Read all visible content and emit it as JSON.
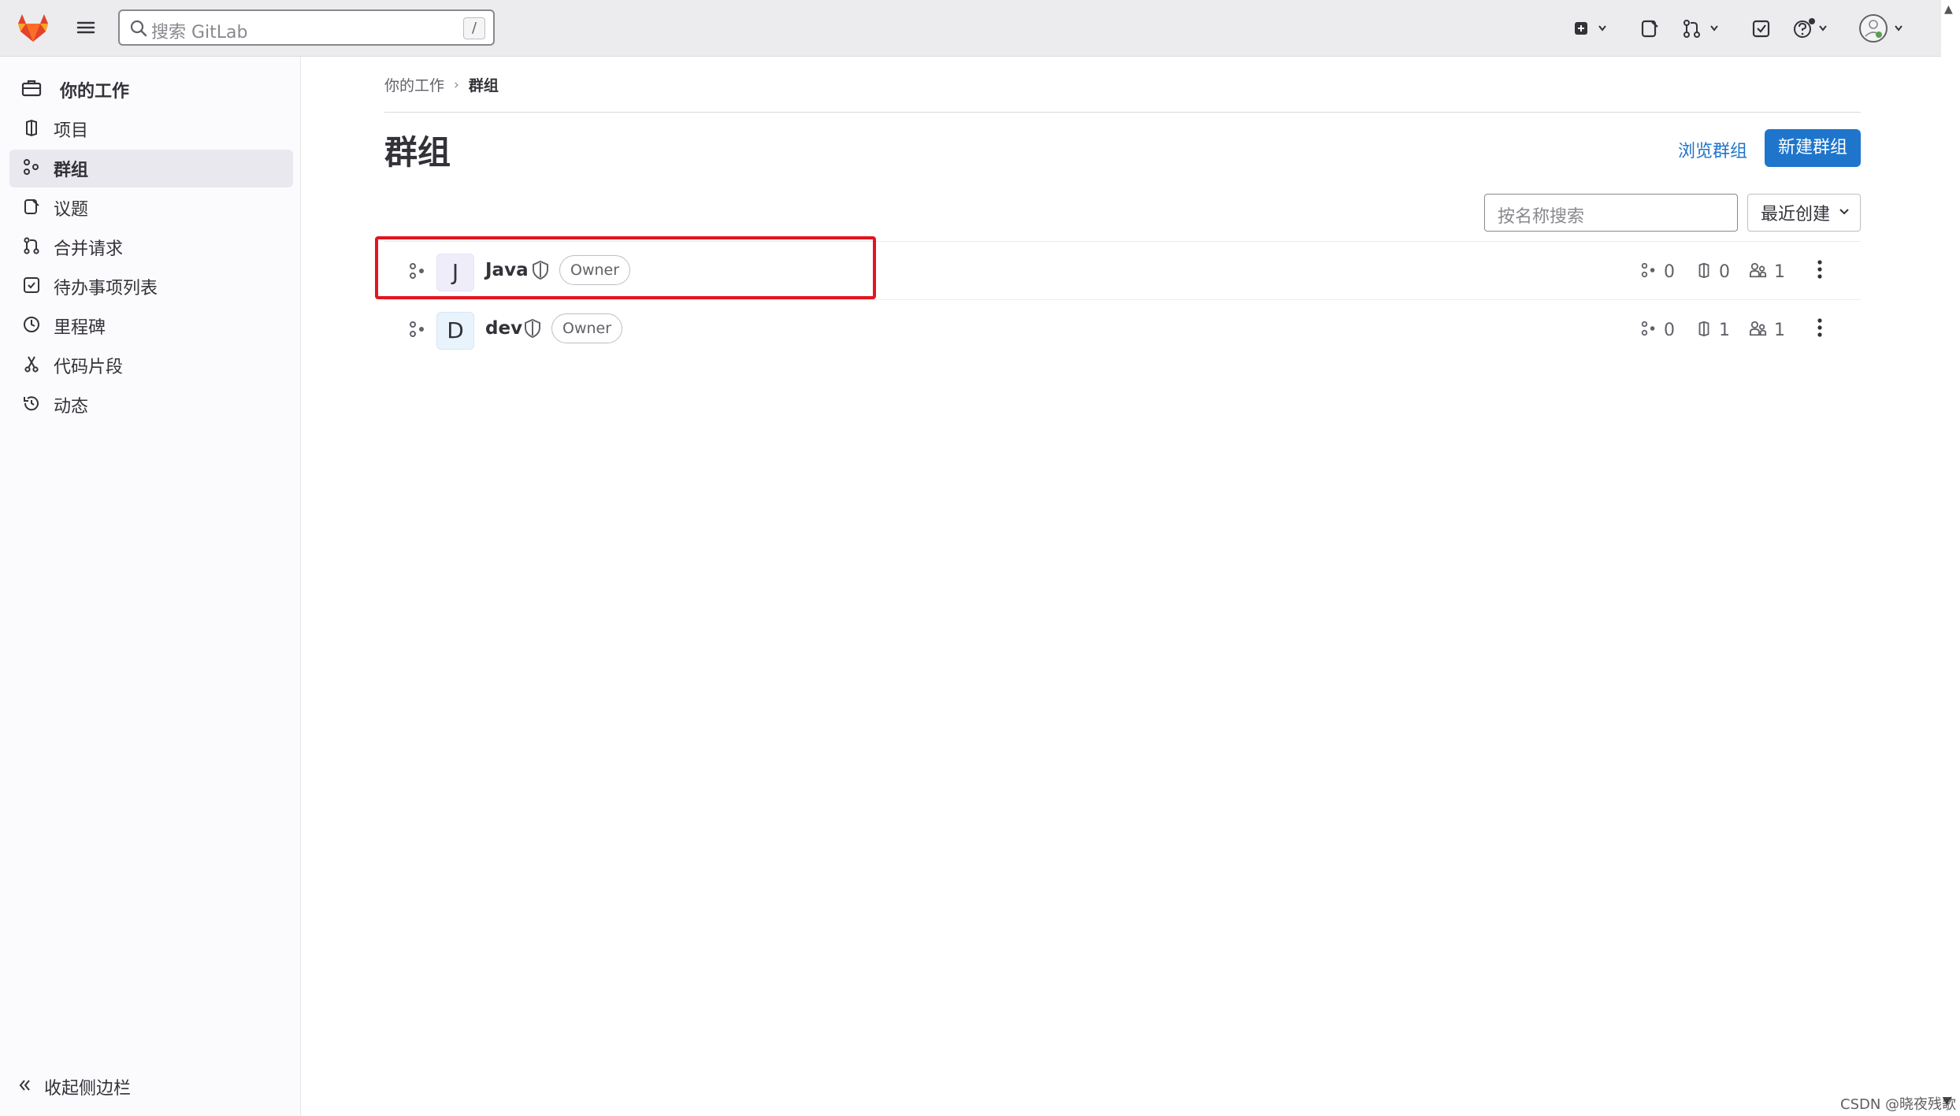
{
  "topbar": {
    "search_placeholder": "搜索 GitLab",
    "search_shortcut": "/",
    "icons": [
      "gitlab-logo",
      "hamburger-icon",
      "new-item-icon",
      "issues-icon",
      "merge-requests-icon",
      "todo-icon",
      "help-icon",
      "user-avatar"
    ]
  },
  "sidebar": {
    "context_label": "你的工作",
    "items": [
      {
        "label": "项目",
        "icon": "project-icon"
      },
      {
        "label": "群组",
        "icon": "group-icon",
        "active": true
      },
      {
        "label": "议题",
        "icon": "issues-icon"
      },
      {
        "label": "合并请求",
        "icon": "merge-request-icon"
      },
      {
        "label": "待办事项列表",
        "icon": "todo-icon"
      },
      {
        "label": "里程碑",
        "icon": "clock-icon"
      },
      {
        "label": "代码片段",
        "icon": "snippet-icon"
      },
      {
        "label": "动态",
        "icon": "history-icon"
      }
    ],
    "collapse_label": "收起侧边栏"
  },
  "breadcrumb": {
    "parent": "你的工作",
    "current": "群组"
  },
  "page": {
    "title": "群组",
    "explore_link": "浏览群组",
    "new_button": "新建群组",
    "filter_placeholder": "按名称搜索",
    "sort_label": "最近创建"
  },
  "groups": [
    {
      "initial": "J",
      "name": "Java",
      "role": "Owner",
      "subgroups": "0",
      "projects": "0",
      "members": "1"
    },
    {
      "initial": "D",
      "name": "dev",
      "role": "Owner",
      "subgroups": "0",
      "projects": "1",
      "members": "1"
    }
  ],
  "watermark": "CSDN @晓夜残歌",
  "colors": {
    "accent": "#1f75cb",
    "highlight": "#e4141e",
    "sidebar_bg": "#fbfafd",
    "topbar_bg": "#ececef"
  }
}
